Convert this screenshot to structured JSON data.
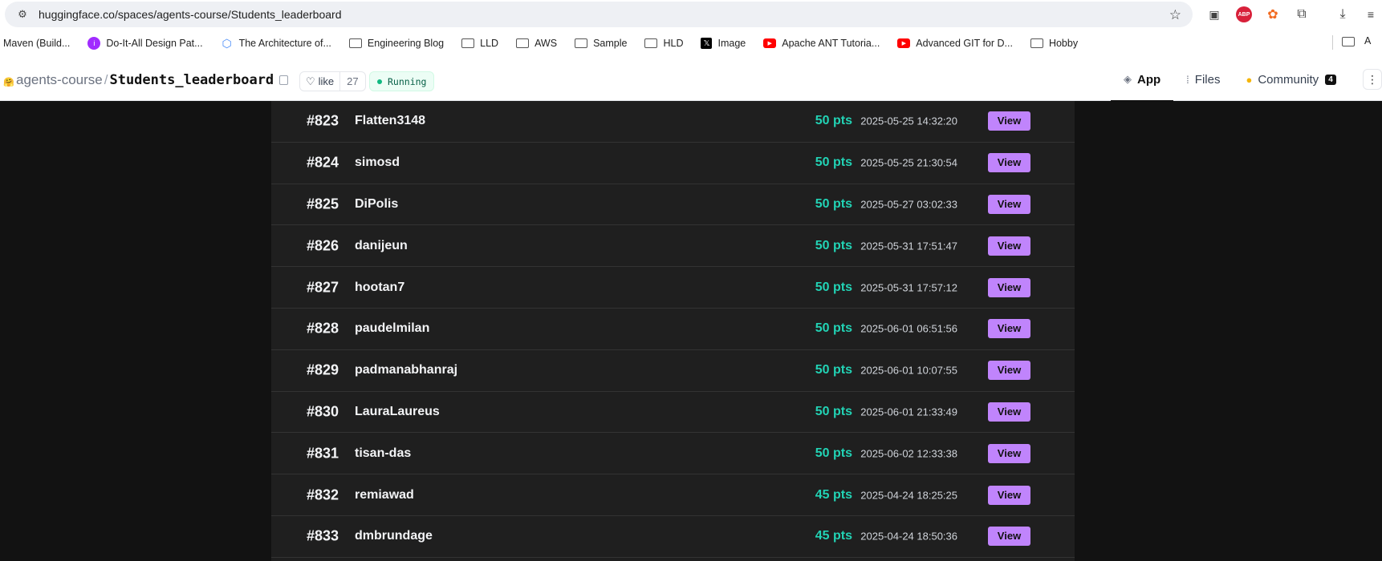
{
  "browser": {
    "url": "huggingface.co/spaces/agents-course/Students_leaderboard",
    "site_info_icon": "tune-icon",
    "bookmark_icon": "star-icon",
    "extensions": [
      {
        "name": "reader-icon",
        "glyph": "▣"
      },
      {
        "name": "adblock-icon",
        "glyph": "ABP"
      },
      {
        "name": "flame-extension-icon",
        "glyph": "✿"
      },
      {
        "name": "puzzle-icon",
        "glyph": "⧉"
      },
      {
        "name": "download-icon",
        "glyph": "⤓"
      },
      {
        "name": "media-control-icon",
        "glyph": "≡"
      }
    ],
    "bookmarks": [
      {
        "label": "Maven (Build...",
        "icon": "none"
      },
      {
        "label": "Do-It-All Design Pat...",
        "icon": "purple"
      },
      {
        "label": "The Architecture of...",
        "icon": "arch"
      },
      {
        "label": "Engineering Blog",
        "icon": "folder"
      },
      {
        "label": "LLD",
        "icon": "folder"
      },
      {
        "label": "AWS",
        "icon": "folder"
      },
      {
        "label": "Sample",
        "icon": "folder"
      },
      {
        "label": "HLD",
        "icon": "folder"
      },
      {
        "label": "Image",
        "icon": "x"
      },
      {
        "label": "Apache ANT Tutoria...",
        "icon": "yt"
      },
      {
        "label": "Advanced GIT for D...",
        "icon": "yt"
      },
      {
        "label": "Hobby",
        "icon": "folder"
      }
    ],
    "bookmarks_overflow_label": "A"
  },
  "space": {
    "owner": "agents-course",
    "separator": "/",
    "name": "Students_leaderboard",
    "like_label": "like",
    "like_count": "27",
    "status": "Running",
    "tabs": [
      {
        "label": "App",
        "icon": "cube-icon",
        "glyph": "◈",
        "active": true
      },
      {
        "label": "Files",
        "icon": "files-icon",
        "glyph": "⁞",
        "active": false
      },
      {
        "label": "Community",
        "icon": "community-icon",
        "glyph": "●",
        "active": false,
        "badge": "4"
      }
    ],
    "more_glyph": "⋮"
  },
  "leaderboard": {
    "view_label": "View",
    "rows": [
      {
        "rank": "#823",
        "user": "Flatten3148",
        "points": "50 pts",
        "date": "2025-05-25 14:32:20"
      },
      {
        "rank": "#824",
        "user": "simosd",
        "points": "50 pts",
        "date": "2025-05-25 21:30:54"
      },
      {
        "rank": "#825",
        "user": "DiPolis",
        "points": "50 pts",
        "date": "2025-05-27 03:02:33"
      },
      {
        "rank": "#826",
        "user": "danijeun",
        "points": "50 pts",
        "date": "2025-05-31 17:51:47"
      },
      {
        "rank": "#827",
        "user": "hootan7",
        "points": "50 pts",
        "date": "2025-05-31 17:57:12"
      },
      {
        "rank": "#828",
        "user": "paudelmilan",
        "points": "50 pts",
        "date": "2025-06-01 06:51:56"
      },
      {
        "rank": "#829",
        "user": "padmanabhanraj",
        "points": "50 pts",
        "date": "2025-06-01 10:07:55"
      },
      {
        "rank": "#830",
        "user": "LauraLaureus",
        "points": "50 pts",
        "date": "2025-06-01 21:33:49"
      },
      {
        "rank": "#831",
        "user": "tisan-das",
        "points": "50 pts",
        "date": "2025-06-02 12:33:38"
      },
      {
        "rank": "#832",
        "user": "remiawad",
        "points": "45 pts",
        "date": "2025-04-24 18:25:25"
      },
      {
        "rank": "#833",
        "user": "dmbrundage",
        "points": "45 pts",
        "date": "2025-04-24 18:50:36"
      }
    ]
  },
  "colors": {
    "background": "#121212",
    "board": "#1f1f1f",
    "points": "#22d3b5",
    "view_button": "#c084fc",
    "status_dot": "#10b981"
  }
}
